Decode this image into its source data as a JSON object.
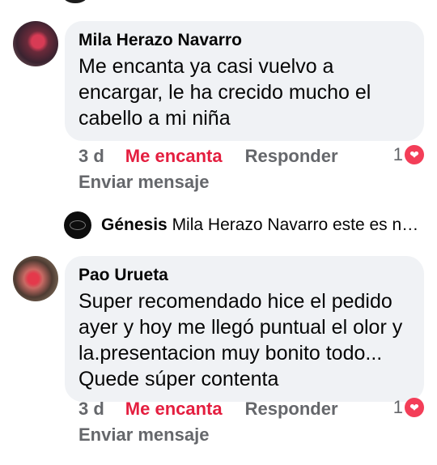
{
  "comments": [
    {
      "author": "Mila Herazo Navarro",
      "lines": [
        "Me encanta ya casi vuelvo a",
        "encargar, le ha crecido mucho el",
        "cabello a mi niña"
      ],
      "time": "3 d",
      "reaction_label": "Me encanta",
      "reply_label": "Responder",
      "reaction_count": "1",
      "send_label": "Enviar mensaje"
    },
    {
      "author": "Pao Urueta",
      "lines": [
        "Super recomendado hice el pedido",
        "ayer y hoy me llegó puntual el olor y",
        "la.presentacion muy bonito todo...",
        "Quede súper contenta"
      ],
      "time": "3 d",
      "reaction_label": "Me encanta",
      "reply_label": "Responder",
      "reaction_count": "1",
      "send_label": "Enviar mensaje"
    }
  ],
  "reply_preview": {
    "author": "Génesis",
    "text": "Mila Herazo Navarro este es nu..."
  },
  "colors": {
    "bubble": "#f0f2f5",
    "love_red": "#e41e3f",
    "muted": "#65676b",
    "heart": "#f33e58"
  },
  "icons": {
    "reaction": "heart-icon"
  }
}
